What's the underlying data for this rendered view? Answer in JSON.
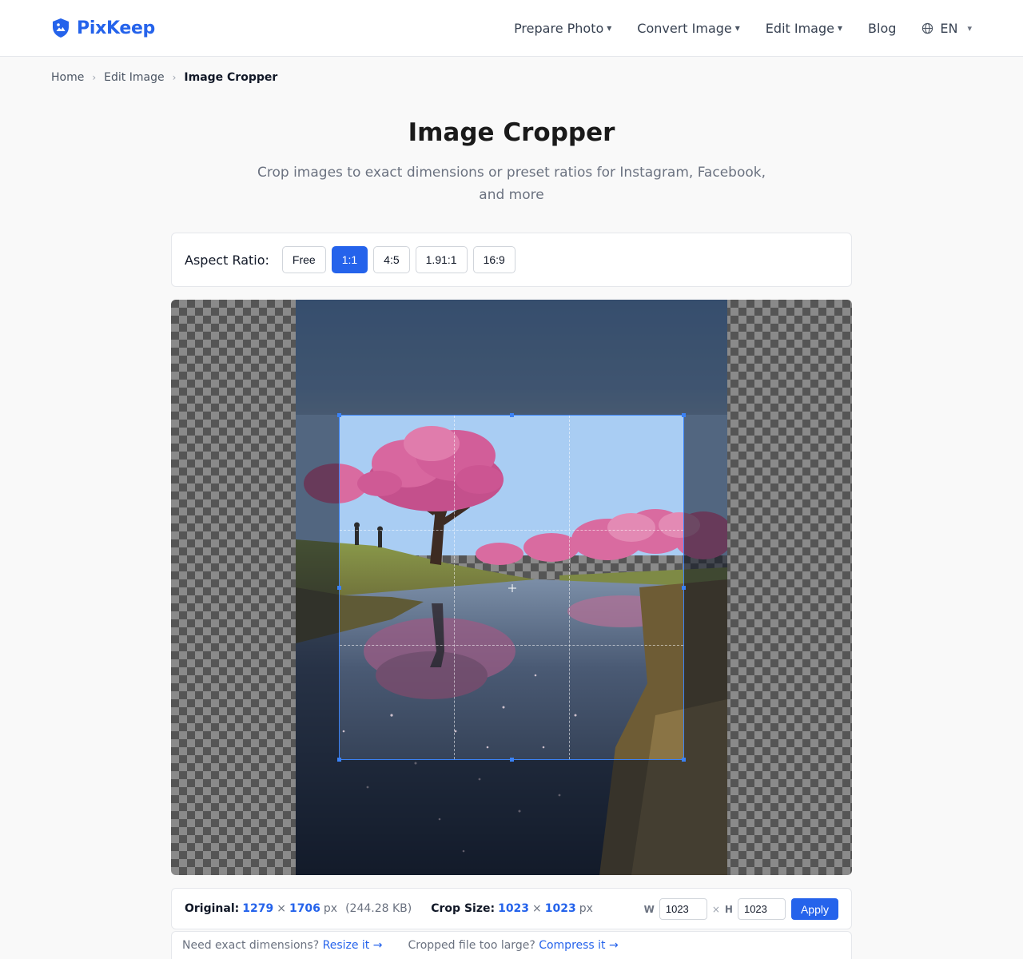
{
  "brand": {
    "name": "PixKeep",
    "color": "#2563eb",
    "icon": "shield-photo-icon"
  },
  "nav": {
    "items": [
      {
        "label": "Prepare Photo",
        "caret": "▾"
      },
      {
        "label": "Convert Image",
        "caret": "▾"
      },
      {
        "label": "Edit Image",
        "caret": "▾"
      },
      {
        "label": "Blog"
      }
    ],
    "language": {
      "label": "EN",
      "icon": "globe-icon",
      "caret": "▾"
    }
  },
  "breadcrumb": {
    "items": [
      "Home",
      "Edit Image"
    ],
    "separator": "›",
    "current": "Image Cropper"
  },
  "page": {
    "title": "Image Cropper",
    "subtitle": "Crop images to exact dimensions or preset ratios for Instagram, Facebook, and more"
  },
  "aspect_ratio": {
    "label": "Aspect Ratio:",
    "options": [
      "Free",
      "1:1",
      "4:5",
      "1.91:1",
      "16:9"
    ],
    "selected": "1:1"
  },
  "info": {
    "original_label": "Original:",
    "original_w": "1279",
    "original_h": "1706",
    "times": "×",
    "unit": "px",
    "file_size": "(244.28 KB)",
    "crop_label": "Crop Size:",
    "crop_w": "1023",
    "crop_h": "1023",
    "w_label": "W",
    "h_label": "H",
    "w_value": "1023",
    "h_value": "1023",
    "apply_label": "Apply"
  },
  "links": {
    "resize_prompt": "Need exact dimensions?",
    "resize_link": "Resize it →",
    "compress_prompt": "Cropped file too large?",
    "compress_link": "Compress it →"
  }
}
